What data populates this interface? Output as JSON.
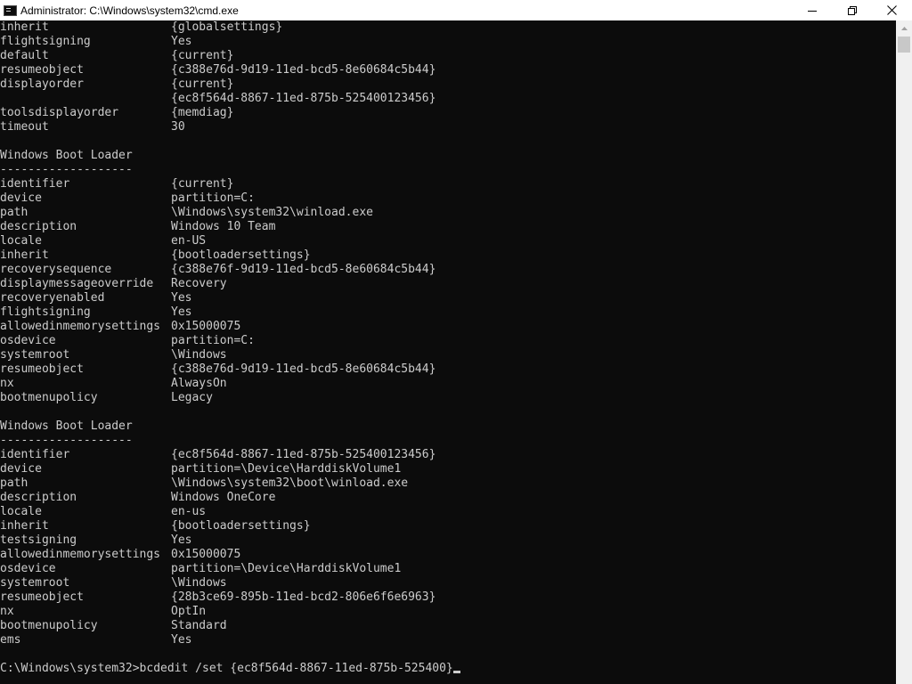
{
  "window": {
    "title": "Administrator: C:\\Windows\\system32\\cmd.exe",
    "icon": "cmd-icon"
  },
  "controls": {
    "minimize": "minimize-icon",
    "maximize": "restore-icon",
    "close": "close-icon"
  },
  "console": {
    "lines": [
      {
        "key": "inherit",
        "value": "{globalsettings}"
      },
      {
        "key": "flightsigning",
        "value": "Yes"
      },
      {
        "key": "default",
        "value": "{current}"
      },
      {
        "key": "resumeobject",
        "value": "{c388e76d-9d19-11ed-bcd5-8e60684c5b44}"
      },
      {
        "key": "displayorder",
        "value": "{current}"
      },
      {
        "key": "",
        "value": "{ec8f564d-8867-11ed-875b-525400123456}"
      },
      {
        "key": "toolsdisplayorder",
        "value": "{memdiag}"
      },
      {
        "key": "timeout",
        "value": "30"
      },
      {
        "key": "",
        "value": ""
      },
      {
        "key": "Windows Boot Loader",
        "value": ""
      },
      {
        "key": "-------------------",
        "value": ""
      },
      {
        "key": "identifier",
        "value": "{current}"
      },
      {
        "key": "device",
        "value": "partition=C:"
      },
      {
        "key": "path",
        "value": "\\Windows\\system32\\winload.exe"
      },
      {
        "key": "description",
        "value": "Windows 10 Team"
      },
      {
        "key": "locale",
        "value": "en-US"
      },
      {
        "key": "inherit",
        "value": "{bootloadersettings}"
      },
      {
        "key": "recoverysequence",
        "value": "{c388e76f-9d19-11ed-bcd5-8e60684c5b44}"
      },
      {
        "key": "displaymessageoverride",
        "value": "Recovery"
      },
      {
        "key": "recoveryenabled",
        "value": "Yes"
      },
      {
        "key": "flightsigning",
        "value": "Yes"
      },
      {
        "key": "allowedinmemorysettings",
        "value": "0x15000075"
      },
      {
        "key": "osdevice",
        "value": "partition=C:"
      },
      {
        "key": "systemroot",
        "value": "\\Windows"
      },
      {
        "key": "resumeobject",
        "value": "{c388e76d-9d19-11ed-bcd5-8e60684c5b44}"
      },
      {
        "key": "nx",
        "value": "AlwaysOn"
      },
      {
        "key": "bootmenupolicy",
        "value": "Legacy"
      },
      {
        "key": "",
        "value": ""
      },
      {
        "key": "Windows Boot Loader",
        "value": ""
      },
      {
        "key": "-------------------",
        "value": ""
      },
      {
        "key": "identifier",
        "value": "{ec8f564d-8867-11ed-875b-525400123456}"
      },
      {
        "key": "device",
        "value": "partition=\\Device\\HarddiskVolume1"
      },
      {
        "key": "path",
        "value": "\\Windows\\system32\\boot\\winload.exe"
      },
      {
        "key": "description",
        "value": "Windows OneCore"
      },
      {
        "key": "locale",
        "value": "en-us"
      },
      {
        "key": "inherit",
        "value": "{bootloadersettings}"
      },
      {
        "key": "testsigning",
        "value": "Yes"
      },
      {
        "key": "allowedinmemorysettings",
        "value": "0x15000075"
      },
      {
        "key": "osdevice",
        "value": "partition=\\Device\\HarddiskVolume1"
      },
      {
        "key": "systemroot",
        "value": "\\Windows"
      },
      {
        "key": "resumeobject",
        "value": "{28b3ce69-895b-11ed-bcd2-806e6f6e6963}"
      },
      {
        "key": "nx",
        "value": "OptIn"
      },
      {
        "key": "bootmenupolicy",
        "value": "Standard"
      },
      {
        "key": "ems",
        "value": "Yes"
      },
      {
        "key": "",
        "value": ""
      }
    ],
    "prompt": "C:\\Windows\\system32>",
    "command": "bcdedit /set {ec8f564d-8867-11ed-875b-525400}"
  },
  "colors": {
    "background": "#0c0c0c",
    "text": "#cccccc",
    "titlebar": "#ffffff",
    "scrollbar": "#f0f0f0",
    "thumb": "#c8c8c8"
  }
}
